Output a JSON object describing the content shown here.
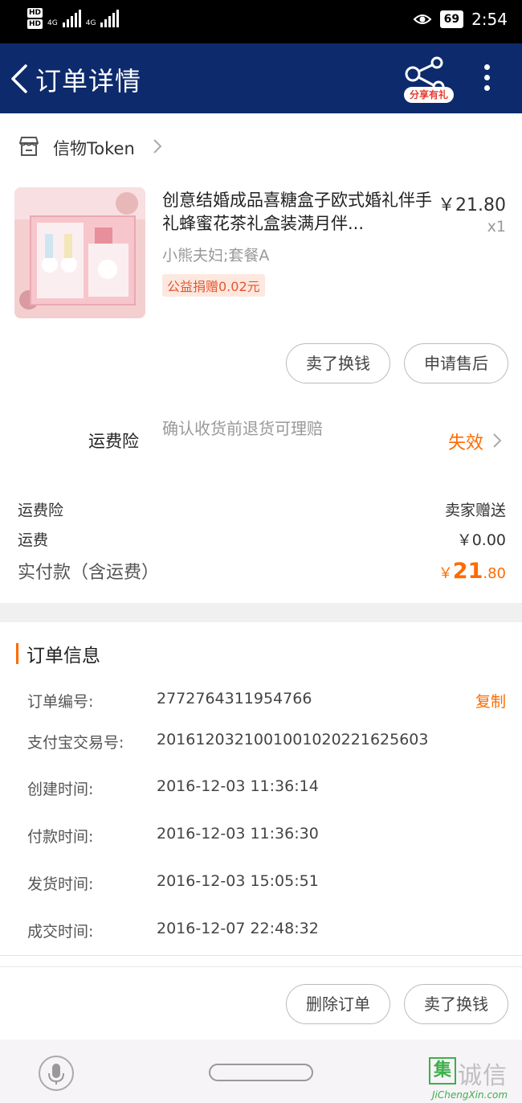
{
  "status_bar": {
    "hd1": "HD",
    "hd2": "HD",
    "net1": "4G",
    "net2": "4G",
    "battery": "69",
    "time": "2:54",
    "icons": [
      "eye-comfort-icon",
      "battery-icon"
    ]
  },
  "nav": {
    "title": "订单详情",
    "share_badge": "分享有礼",
    "icons": [
      "back-icon",
      "share-icon",
      "more-icon"
    ]
  },
  "shop": {
    "name": "信物Token",
    "icons": [
      "store-icon",
      "chevron-right-icon"
    ]
  },
  "product": {
    "title": "创意结婚成品喜糖盒子欧式婚礼伴手礼蜂蜜花茶礼盒装满月伴...",
    "price": "￥21.80",
    "quantity": "x1",
    "spec": "小熊夫妇;套餐A",
    "charity": "公益捐赠0.02元"
  },
  "product_actions": {
    "sell_label": "卖了换钱",
    "after_sale_label": "申请售后"
  },
  "insurance": {
    "label": "运费险",
    "description": "确认收货前退货可理赔",
    "status": "失效"
  },
  "fees": {
    "insurance_label": "运费险",
    "insurance_value": "卖家赠送",
    "shipping_label": "运费",
    "shipping_value": "￥0.00",
    "total_label": "实付款（含运费）",
    "total_currency": "￥",
    "total_int": "21",
    "total_dec": ".80"
  },
  "order_info": {
    "title": "订单信息",
    "copy_label": "复制",
    "rows": [
      {
        "key": "订单编号:",
        "value": "2772764311954766"
      },
      {
        "key": "支付宝交易号:",
        "value": "2016120321001001020221625603"
      },
      {
        "key": "创建时间:",
        "value": "2016-12-03 11:36:14"
      },
      {
        "key": "付款时间:",
        "value": "2016-12-03 11:36:30"
      },
      {
        "key": "发货时间:",
        "value": "2016-12-03 15:05:51"
      },
      {
        "key": "成交时间:",
        "value": "2016-12-07 22:48:32"
      }
    ]
  },
  "bottom_actions": {
    "delete_label": "删除订单",
    "sell_label": "卖了换钱"
  },
  "watermark": {
    "box_char": "集",
    "cn": "诚信",
    "en": "JiChengXin.com"
  },
  "colors": {
    "nav_bg": "#0d2a6c",
    "accent": "#ff6a00"
  }
}
